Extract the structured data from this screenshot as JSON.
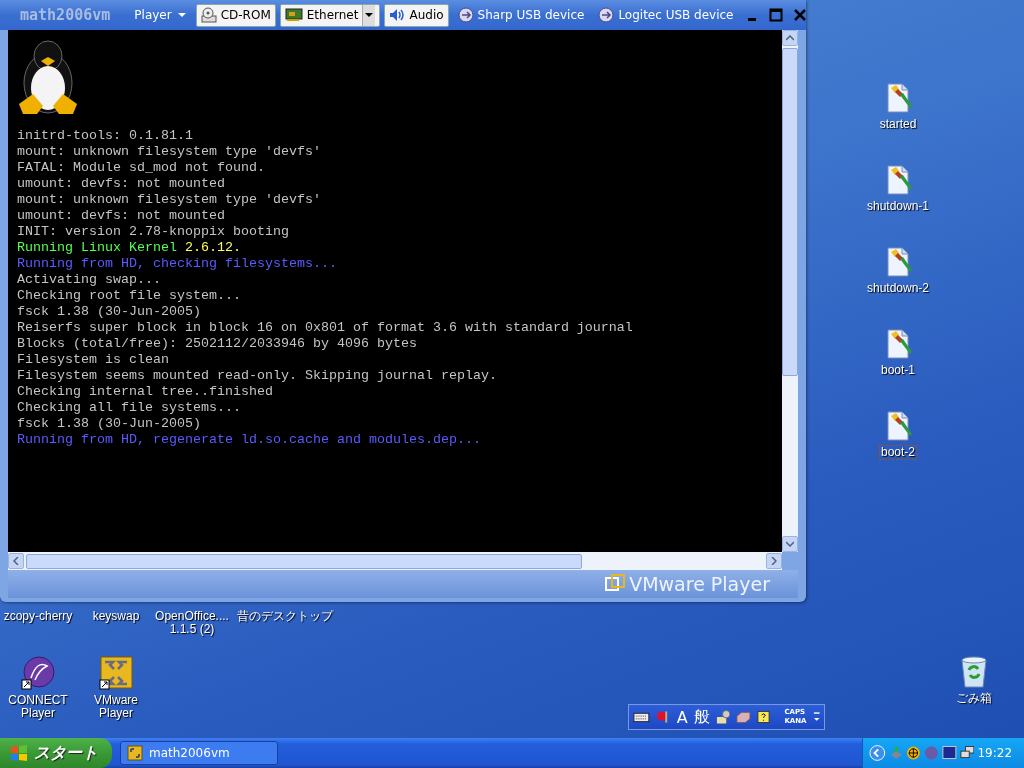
{
  "window": {
    "title": "math2006vm",
    "menu": "Player",
    "devices": [
      {
        "label": "CD-ROM",
        "kind": "cdrom",
        "connected": true,
        "dropdown": false
      },
      {
        "label": "Ethernet",
        "kind": "network",
        "connected": true,
        "dropdown": true
      },
      {
        "label": "Audio",
        "kind": "audio",
        "connected": true,
        "dropdown": false
      },
      {
        "label": "Sharp USB device",
        "kind": "usb",
        "connected": false,
        "dropdown": false
      },
      {
        "label": "Logitec USB device",
        "kind": "usb",
        "connected": false,
        "dropdown": false
      }
    ],
    "console": {
      "lines": [
        {
          "segments": [
            {
              "text": "initrd-tools: 0.1.81.1",
              "kind": "plain"
            }
          ]
        },
        {
          "segments": [
            {
              "text": "mount: unknown filesystem type 'devfs'",
              "kind": "plain"
            }
          ]
        },
        {
          "segments": [
            {
              "text": "FATAL: Module sd_mod not found.",
              "kind": "plain"
            }
          ]
        },
        {
          "segments": [
            {
              "text": "umount: devfs: not mounted",
              "kind": "plain"
            }
          ]
        },
        {
          "segments": [
            {
              "text": "mount: unknown filesystem type 'devfs'",
              "kind": "plain"
            }
          ]
        },
        {
          "segments": [
            {
              "text": "umount: devfs: not mounted",
              "kind": "plain"
            }
          ]
        },
        {
          "segments": [
            {
              "text": "INIT: version 2.78-knoppix booting",
              "kind": "plain"
            }
          ]
        },
        {
          "segments": [
            {
              "text": "Running Linux Kernel ",
              "kind": "success"
            },
            {
              "text": "2.6.12.",
              "kind": "version"
            }
          ]
        },
        {
          "segments": [
            {
              "text": "Running from HD, checking filesystems...",
              "kind": "progress"
            }
          ]
        },
        {
          "segments": [
            {
              "text": "Activating swap...",
              "kind": "plain"
            }
          ]
        },
        {
          "segments": [
            {
              "text": "Checking root file system...",
              "kind": "plain"
            }
          ]
        },
        {
          "segments": [
            {
              "text": "fsck 1.38 (30-Jun-2005)",
              "kind": "plain"
            }
          ]
        },
        {
          "segments": [
            {
              "text": "Reiserfs super block in block 16 on 0x801 of format 3.6 with standard journal",
              "kind": "plain"
            }
          ]
        },
        {
          "segments": [
            {
              "text": "Blocks (total/free): 2502112/2033946 by 4096 bytes",
              "kind": "plain"
            }
          ]
        },
        {
          "segments": [
            {
              "text": "Filesystem is clean",
              "kind": "plain"
            }
          ]
        },
        {
          "segments": [
            {
              "text": "Filesystem seems mounted read-only. Skipping journal replay.",
              "kind": "plain"
            }
          ]
        },
        {
          "segments": [
            {
              "text": "Checking internal tree..finished",
              "kind": "plain"
            }
          ]
        },
        {
          "segments": [
            {
              "text": "Checking all file systems...",
              "kind": "plain"
            }
          ]
        },
        {
          "segments": [
            {
              "text": "fsck 1.38 (30-Jun-2005)",
              "kind": "plain"
            }
          ]
        },
        {
          "segments": [
            {
              "text": "Running from HD, regenerate ld.so.cache and modules.dep...",
              "kind": "progress"
            }
          ]
        }
      ]
    },
    "brand": "VMware Player"
  },
  "desktop": {
    "right_icons": [
      {
        "label": "started",
        "selected": false
      },
      {
        "label": "shutdown-1",
        "selected": false
      },
      {
        "label": "shutdown-2",
        "selected": false
      },
      {
        "label": "boot-1",
        "selected": false
      },
      {
        "label": "boot-2",
        "selected": true
      }
    ],
    "covered_icons": [
      {
        "label": "zcopy-cherry"
      },
      {
        "label": "keyswap"
      },
      {
        "label": "OpenOffice.... 1.1.5 (2)"
      },
      {
        "label": "昔のデスクトップ"
      }
    ],
    "shortcuts": [
      {
        "label": "CONNECT Player",
        "kind": "connect"
      },
      {
        "label": "VMware Player",
        "kind": "vmware"
      }
    ],
    "recycle_bin": {
      "label": "ごみ箱"
    }
  },
  "language_bar": {
    "input_mode": "A",
    "dictionary": "般",
    "caps": "CAPS",
    "kana": "KANA"
  },
  "taskbar": {
    "start": "スタート",
    "tasks": [
      {
        "label": "math2006vm",
        "selected": false
      }
    ],
    "clock": "19:22"
  }
}
